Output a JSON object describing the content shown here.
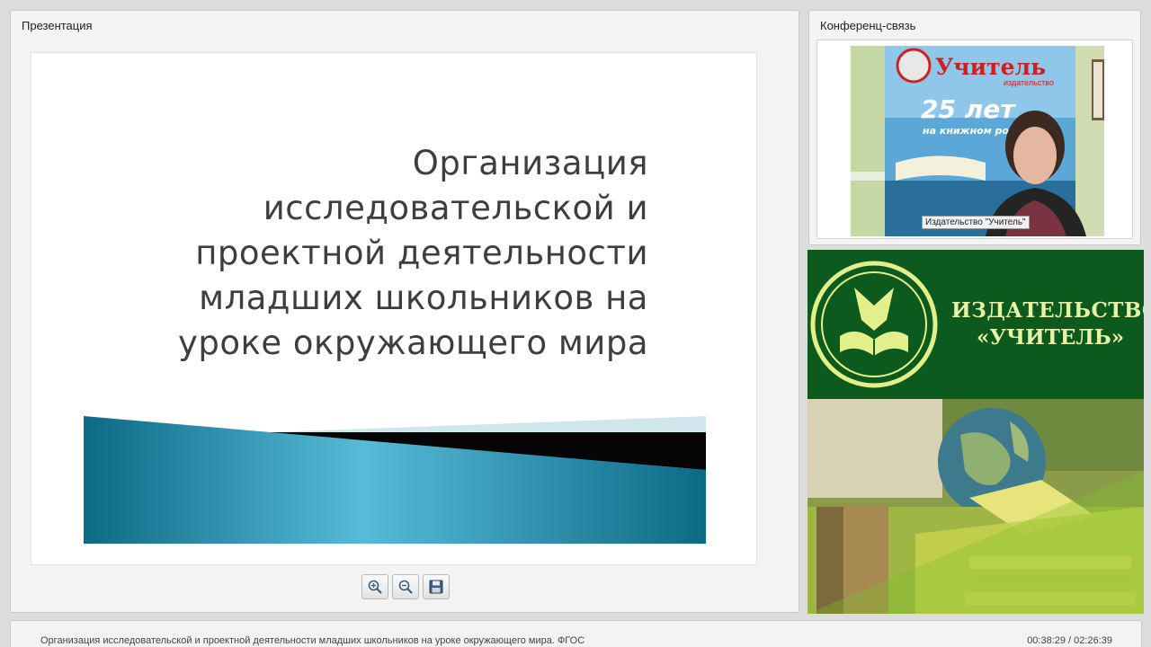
{
  "presentation": {
    "panel_title": "Презентация",
    "slide_title": "Организация исследовательской и проектной деятельности младших школьников на уроке окружающего мира",
    "toolbar": {
      "zoom_in": "zoom-in-icon",
      "zoom_out": "zoom-out-icon",
      "save": "save-icon"
    }
  },
  "conference": {
    "panel_title": "Конференц-связь",
    "speaker_label": "Издательство \"Учитель\"",
    "poster_text_1": "Учитель",
    "poster_text_2": "издательство",
    "poster_text_3": "25 лет",
    "poster_text_4": "на книжном ро"
  },
  "brand": {
    "name_line1": "ИЗДАТЕЛЬСТВО",
    "name_line2": "«УЧИТЕЛЬ»"
  },
  "footer": {
    "title": "Организация исследовательской и проектной деятельности младших школьников на уроке окружающего мира. ФГОС",
    "time": "00:38:29 / 02:26:39"
  },
  "colors": {
    "brand_green": "#0d5a1f",
    "brand_text": "#e9f0a8",
    "slide_shape": "#1f8fb0"
  }
}
